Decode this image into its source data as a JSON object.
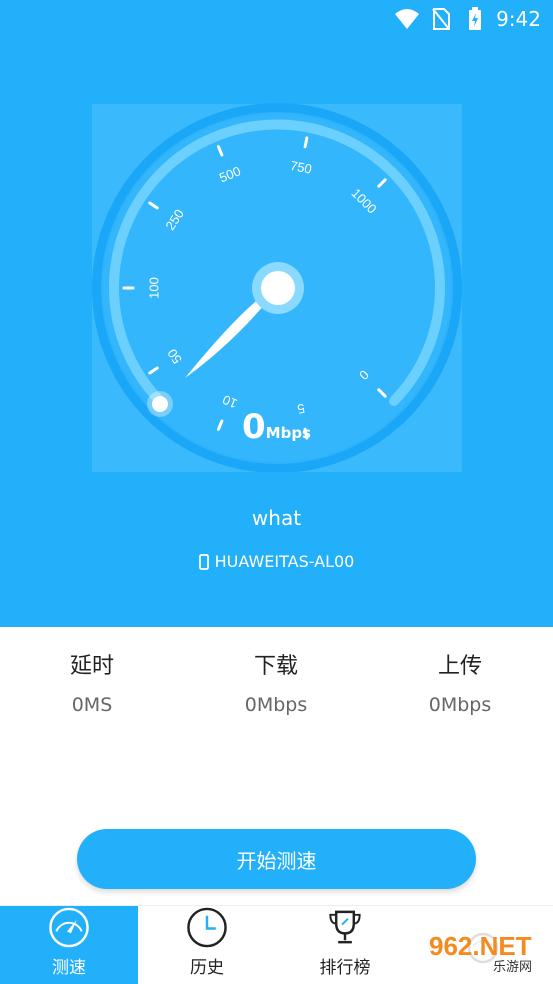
{
  "status_bar": {
    "time": "9:42",
    "icons": [
      "wifi-icon",
      "no-sim-icon",
      "battery-charging-icon"
    ]
  },
  "gauge": {
    "scale_labels": [
      "0",
      "5",
      "10",
      "50",
      "100",
      "250",
      "500",
      "750",
      "1000"
    ],
    "speed_value": "0",
    "speed_unit": "Mbps"
  },
  "network": {
    "ssid": "what",
    "device": "HUAWEITAS-AL00"
  },
  "stats": [
    {
      "label": "延时",
      "value": "0MS"
    },
    {
      "label": "下载",
      "value": "0Mbps"
    },
    {
      "label": "上传",
      "value": "0Mbps"
    }
  ],
  "start_button": {
    "label": "开始测速"
  },
  "tabs": [
    {
      "label": "测速",
      "icon": "speedometer-icon",
      "active": true
    },
    {
      "label": "历史",
      "icon": "clock-icon",
      "active": false
    },
    {
      "label": "排行榜",
      "icon": "trophy-icon",
      "active": false
    },
    {
      "label": "",
      "icon": "profile-icon",
      "active": false
    }
  ],
  "watermark": {
    "text": "962.NET",
    "subtext": "乐游网"
  },
  "colors": {
    "primary": "#22b0fb",
    "background": "#ffffff"
  }
}
